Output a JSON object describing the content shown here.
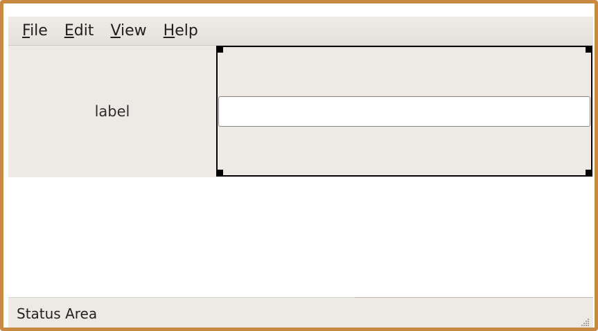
{
  "menubar": {
    "items": [
      {
        "mnemonic": "F",
        "rest": "ile"
      },
      {
        "mnemonic": "E",
        "rest": "dit"
      },
      {
        "mnemonic": "V",
        "rest": "iew"
      },
      {
        "mnemonic": "H",
        "rest": "elp"
      }
    ]
  },
  "content": {
    "label": "label",
    "entry_value": "",
    "entry_placeholder": ""
  },
  "statusbar": {
    "text": "Status Area"
  },
  "colors": {
    "window_border": "#c88a42",
    "panel_background": "#edeae6",
    "selection_outline": "#000000"
  },
  "icons": {
    "resize_grip": "resize-grip-icon"
  }
}
